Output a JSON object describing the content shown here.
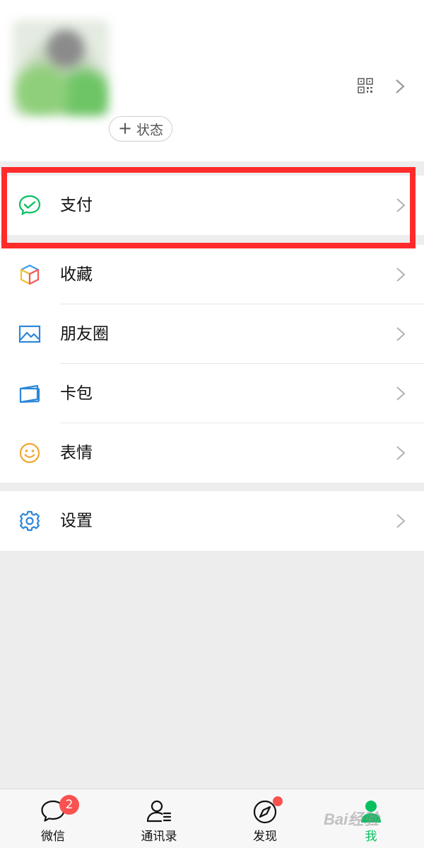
{
  "profile": {
    "status_plus": "+",
    "status_label": "状态"
  },
  "menu_pay": {
    "label": "支付",
    "icon": "wechat-pay-icon"
  },
  "menu_main": [
    {
      "label": "收藏",
      "icon": "favorites-cube-icon"
    },
    {
      "label": "朋友圈",
      "icon": "moments-image-icon"
    },
    {
      "label": "卡包",
      "icon": "card-wallet-icon"
    },
    {
      "label": "表情",
      "icon": "smiley-face-icon"
    }
  ],
  "menu_settings": {
    "label": "设置",
    "icon": "gear-icon"
  },
  "tabbar": {
    "tabs": [
      {
        "label": "微信",
        "icon": "chat-bubble-icon",
        "badge": "2"
      },
      {
        "label": "通讯录",
        "icon": "contacts-icon"
      },
      {
        "label": "发现",
        "icon": "compass-icon"
      },
      {
        "label": "我",
        "icon": "person-icon"
      }
    ]
  },
  "watermark": "Bai经验",
  "colors": {
    "accent_green": "#07c160",
    "highlight_red": "#ff2b2b",
    "badge_red": "#fa5151",
    "background": "#ededed"
  }
}
